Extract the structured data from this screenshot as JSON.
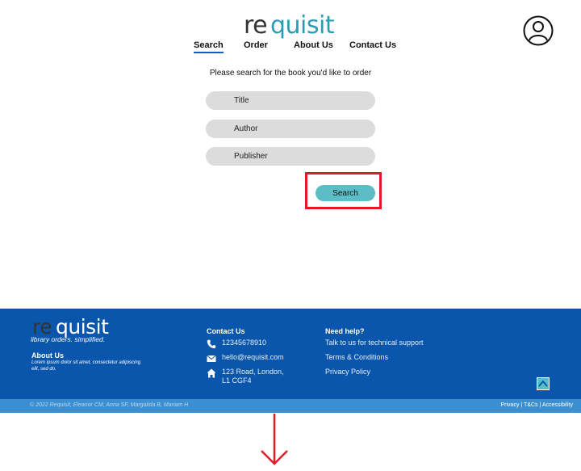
{
  "brand": {
    "logo_prefix": "re",
    "logo_suffix": "quisit",
    "logo_color": "#2a9db5"
  },
  "nav": {
    "items": [
      {
        "label": "Search",
        "active": true
      },
      {
        "label": "Order"
      },
      {
        "label": "About Us"
      },
      {
        "label": "Contact Us"
      }
    ]
  },
  "search": {
    "prompt": "Please search for the book you'd like to order",
    "title_placeholder": "Title",
    "author_placeholder": "Author",
    "publisher_placeholder": "Publisher",
    "button_label": "Search"
  },
  "footer": {
    "logo_prefix": "re",
    "logo_suffix": "quisit",
    "tagline": "library orders. simplified.",
    "about_heading": "About Us",
    "about_text": "Lorem ipsum dolor sit amet, consectetur adipiscing elit, sed do.",
    "contact_heading": "Contact Us",
    "phone": "12345678910",
    "email": "hello@requisit.com",
    "address_line1": "123 Road, London,",
    "address_line2": "L1 CGF4",
    "help_heading": "Need help?",
    "help_links": [
      "Talk to us for technical support",
      "Terms & Conditions",
      "Privacy Policy"
    ],
    "copyright": "© 2022 Requisit, Eleanor CM, Anna SF, Margalida B, Mariam H",
    "legal": [
      "Privacy",
      "T&Cs",
      "Accessibility"
    ],
    "legal_separator": " | "
  },
  "colors": {
    "footer_bg": "#0a56ac",
    "bottom_bar": "#3b8fd1",
    "accent": "#5cbdc6",
    "highlight": "#e01b23"
  }
}
